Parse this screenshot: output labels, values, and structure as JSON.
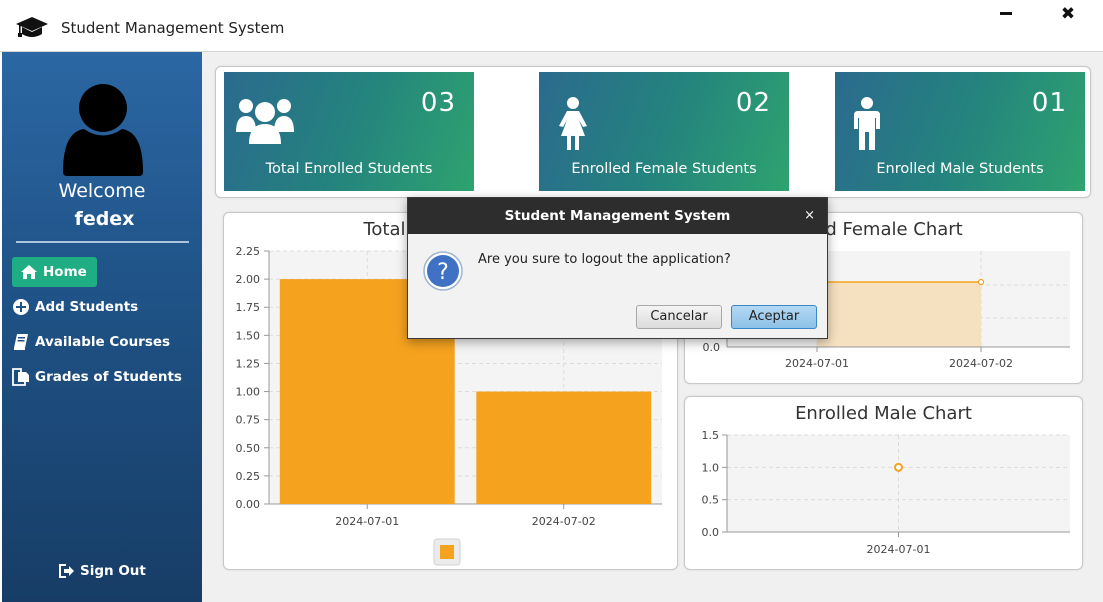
{
  "window": {
    "title": "Student Management System"
  },
  "sidebar": {
    "welcome": "Welcome",
    "username": "fedex",
    "items": [
      {
        "label": "Home",
        "icon": "home-icon",
        "active": true
      },
      {
        "label": "Add Students",
        "icon": "plus-circle-icon"
      },
      {
        "label": "Available Courses",
        "icon": "book-icon"
      },
      {
        "label": "Grades of Students",
        "icon": "documents-icon"
      }
    ],
    "signout": "Sign Out"
  },
  "cards": [
    {
      "count": "03",
      "label": "Total Enrolled Students",
      "icon": "users-icon"
    },
    {
      "count": "02",
      "label": "Enrolled Female Students",
      "icon": "female-icon"
    },
    {
      "count": "01",
      "label": "Enrolled Male Students",
      "icon": "male-icon"
    }
  ],
  "charts": {
    "total_title": "Total",
    "female_title": "lled Female Chart",
    "male_title": "Enrolled Male Chart"
  },
  "chart_data": [
    {
      "type": "bar",
      "title": "Total",
      "categories": [
        "2024-07-01",
        "2024-07-02"
      ],
      "values": [
        2,
        1
      ],
      "ylim": [
        0,
        2.25
      ],
      "yticks": [
        "2.25",
        "2.00",
        "1.75",
        "1.50",
        "1.25",
        "1.00",
        "0.75",
        "0.50",
        "0.25",
        "0.00"
      ],
      "grid": true,
      "color": "#f5a21f"
    },
    {
      "type": "area",
      "title": "lled Female Chart",
      "categories": [
        "2024-07-01",
        "2024-07-02"
      ],
      "values": [
        1,
        1
      ],
      "yticks": [
        "0.0"
      ],
      "grid": true,
      "color": "#f5a21f"
    },
    {
      "type": "scatter",
      "title": "Enrolled Male Chart",
      "categories": [
        "2024-07-01"
      ],
      "values": [
        1
      ],
      "ylim": [
        0,
        1.5
      ],
      "yticks": [
        "1.5",
        "1.0",
        "0.5",
        "0.0"
      ],
      "grid": true,
      "color": "#f5a21f"
    }
  ],
  "dialog": {
    "title": "Student Management System",
    "close": "×",
    "message": "Are you sure to logout the application?",
    "cancel": "Cancelar",
    "ok": "Aceptar",
    "icon": "question-icon"
  },
  "colors": {
    "accent": "#1fae83",
    "bar": "#f5a21f",
    "sidebar": "#1f5286"
  }
}
